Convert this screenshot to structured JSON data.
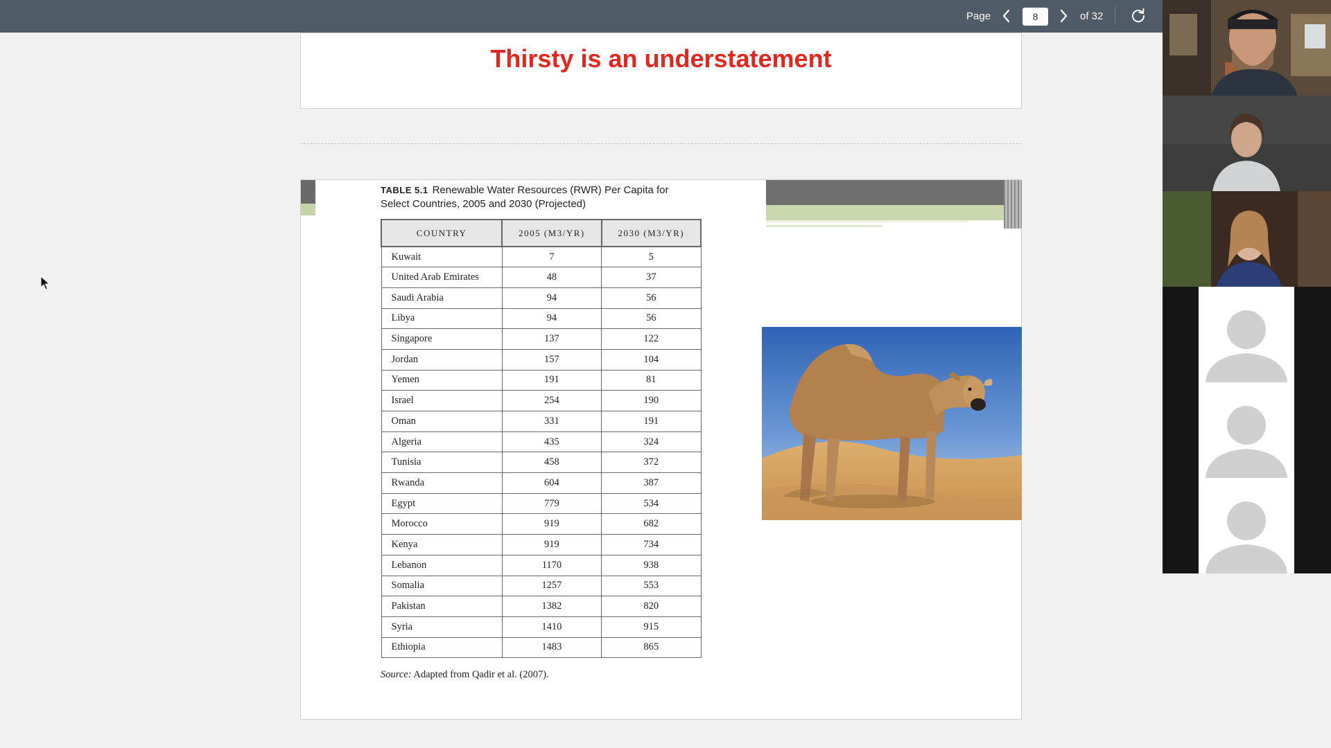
{
  "toolbar": {
    "page_label": "Page",
    "current_page": "8",
    "of_total": "of 32",
    "icons": {
      "prev": "chevron-left-icon",
      "next": "chevron-right-icon",
      "refresh": "rotate-icon"
    }
  },
  "slide_top": {
    "title": "Thirsty is an understatement",
    "title_color": "#e5261f"
  },
  "slide_main": {
    "caption_number": "TABLE 5.1",
    "caption_text": "Renewable Water Resources (RWR) Per Capita for Select Countries, 2005 and 2030 (Projected)",
    "columns": [
      "Country",
      "2005 (m3/yr)",
      "2030 (m3/yr)"
    ],
    "rows": [
      [
        "Kuwait",
        "7",
        "5"
      ],
      [
        "United Arab Emirates",
        "48",
        "37"
      ],
      [
        "Saudi Arabia",
        "94",
        "56"
      ],
      [
        "Libya",
        "94",
        "56"
      ],
      [
        "Singapore",
        "137",
        "122"
      ],
      [
        "Jordan",
        "157",
        "104"
      ],
      [
        "Yemen",
        "191",
        "81"
      ],
      [
        "Israel",
        "254",
        "190"
      ],
      [
        "Oman",
        "331",
        "191"
      ],
      [
        "Algeria",
        "435",
        "324"
      ],
      [
        "Tunisia",
        "458",
        "372"
      ],
      [
        "Rwanda",
        "604",
        "387"
      ],
      [
        "Egypt",
        "779",
        "534"
      ],
      [
        "Morocco",
        "919",
        "682"
      ],
      [
        "Kenya",
        "919",
        "734"
      ],
      [
        "Lebanon",
        "1170",
        "938"
      ],
      [
        "Somalia",
        "1257",
        "553"
      ],
      [
        "Pakistan",
        "1382",
        "820"
      ],
      [
        "Syria",
        "1410",
        "915"
      ],
      [
        "Ethiopia",
        "1483",
        "865"
      ]
    ],
    "source_label": "Source:",
    "source_text": "Adapted from Qadir et al. (2007).",
    "image": "camel-cow-image"
  },
  "video_participants": [
    {
      "type": "video",
      "name": "participant-video-1"
    },
    {
      "type": "video",
      "name": "participant-video-2"
    },
    {
      "type": "video",
      "name": "participant-video-3"
    },
    {
      "type": "avatar",
      "name": "participant-avatar-1"
    },
    {
      "type": "avatar",
      "name": "participant-avatar-2"
    },
    {
      "type": "avatar",
      "name": "participant-avatar-3"
    }
  ],
  "colors": {
    "toolbar": "#4f5b66",
    "page_background": "#f1f1f1",
    "accent_red": "#e5261f"
  }
}
